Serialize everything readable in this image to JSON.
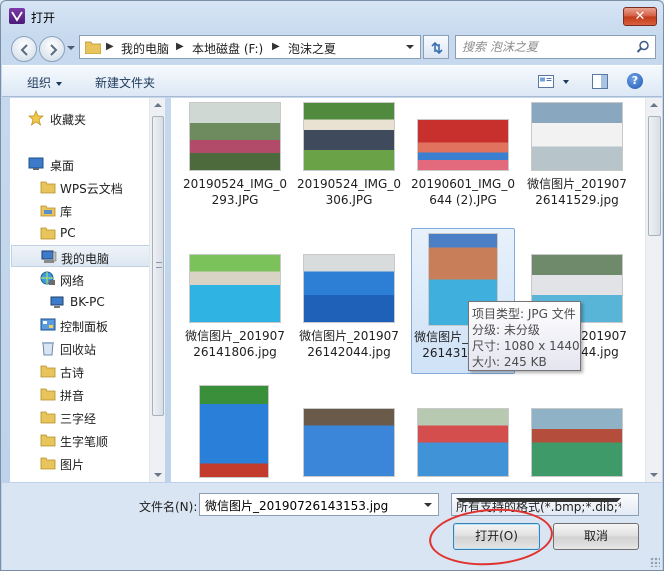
{
  "window": {
    "title": "打开",
    "close_label": "✕"
  },
  "address": {
    "crumbs": [
      "我的电脑",
      "本地磁盘 (F:)",
      "泡沫之夏"
    ],
    "search_placeholder": "搜索 泡沫之夏"
  },
  "toolbar": {
    "organize": "组织",
    "new_folder": "新建文件夹",
    "help": "?"
  },
  "nav": {
    "items": [
      {
        "label": "收藏夹",
        "icon": "star-icon"
      },
      {
        "label": "桌面",
        "icon": "desktop-icon"
      },
      {
        "label": "WPS云文档",
        "icon": "folder-icon"
      },
      {
        "label": "库",
        "icon": "library-icon"
      },
      {
        "label": "PC",
        "icon": "folder-icon"
      },
      {
        "label": "我的电脑",
        "icon": "computer-icon"
      },
      {
        "label": "网络",
        "icon": "network-icon"
      },
      {
        "label": "BK-PC",
        "icon": "pc-icon"
      },
      {
        "label": "控制面板",
        "icon": "control-panel-icon"
      },
      {
        "label": "回收站",
        "icon": "recycle-bin-icon"
      },
      {
        "label": "古诗",
        "icon": "folder-icon"
      },
      {
        "label": "拼音",
        "icon": "folder-icon"
      },
      {
        "label": "三字经",
        "icon": "folder-icon"
      },
      {
        "label": "生字笔顺",
        "icon": "folder-icon"
      },
      {
        "label": "图片",
        "icon": "folder-icon"
      }
    ]
  },
  "files": [
    {
      "name": "20190524_IMG_0293.JPG"
    },
    {
      "name": "20190524_IMG_0306.JPG"
    },
    {
      "name": "20190601_IMG_0644 (2).JPG"
    },
    {
      "name": "微信图片_20190726141529.jpg"
    },
    {
      "name": "微信图片_20190726141806.jpg"
    },
    {
      "name": "微信图片_20190726142044.jpg"
    },
    {
      "name": "微信图片_20190726143153.jpg"
    },
    {
      "name": "微信图片_20190726141544.jpg"
    },
    {
      "name": ""
    },
    {
      "name": ""
    },
    {
      "name": ""
    },
    {
      "name": ""
    }
  ],
  "tooltip": {
    "type": "项目类型: JPG 文件",
    "rating": "分级: 未分级",
    "size": "尺寸: 1080 x 1440",
    "filesize": "大小: 245 KB"
  },
  "bottom": {
    "filename_label": "文件名(N):",
    "filename_value": "微信图片_20190726143153.jpg",
    "filetype": "所有支持的格式(*.bmp;*.dib;*.",
    "open_label": "打开(O)",
    "cancel_label": "取消"
  },
  "colors": {
    "accent_red": "#e0332f",
    "selection": "#cfe2f7"
  }
}
